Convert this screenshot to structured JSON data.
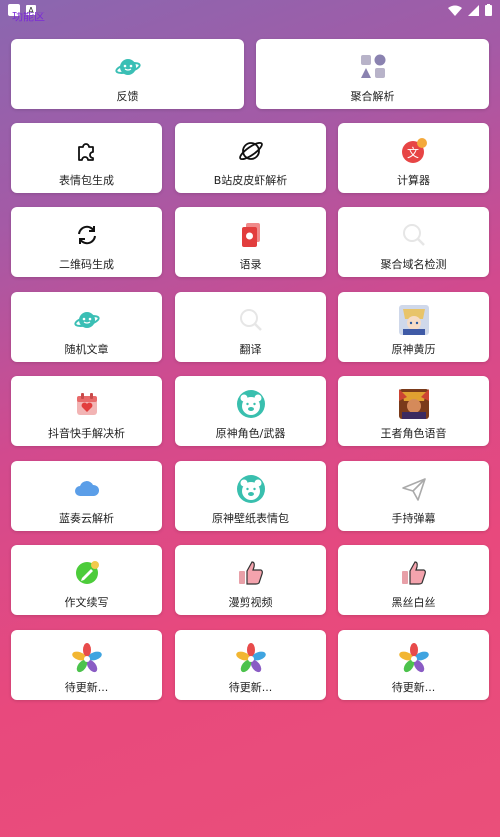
{
  "page_title": "功能区",
  "row0": [
    {
      "label": "反馈",
      "icon": "planet-emoji-icon"
    },
    {
      "label": "聚合解析",
      "icon": "shapes-icon"
    }
  ],
  "grid": [
    {
      "label": "表情包生成",
      "icon": "puzzle-icon"
    },
    {
      "label": "B站皮皮虾解析",
      "icon": "planet-outline-icon"
    },
    {
      "label": "计算器",
      "icon": "translate-badge-icon"
    },
    {
      "label": "二维码生成",
      "icon": "refresh-icon"
    },
    {
      "label": "语录",
      "icon": "red-book-icon"
    },
    {
      "label": "聚合域名检测",
      "icon": "search-icon"
    },
    {
      "label": "随机文章",
      "icon": "planet-emoji-icon"
    },
    {
      "label": "翻译",
      "icon": "search-icon"
    },
    {
      "label": "原神黄历",
      "icon": "anime-avatar-icon"
    },
    {
      "label": "抖音快手解决析",
      "icon": "calendar-heart-icon"
    },
    {
      "label": "原神角色/武器",
      "icon": "bear-face-icon"
    },
    {
      "label": "王者角色语音",
      "icon": "game-avatar-icon"
    },
    {
      "label": "蓝奏云解析",
      "icon": "cloud-icon"
    },
    {
      "label": "原神壁纸表情包",
      "icon": "bear-face-icon"
    },
    {
      "label": "手持弹幕",
      "icon": "paper-plane-icon"
    },
    {
      "label": "作文续写",
      "icon": "pencil-badge-icon"
    },
    {
      "label": "漫剪视频",
      "icon": "thumbs-up-icon"
    },
    {
      "label": "黑丝白丝",
      "icon": "thumbs-up-icon"
    },
    {
      "label": "待更新...",
      "icon": "flower-icon"
    },
    {
      "label": "待更新...",
      "icon": "flower-icon"
    },
    {
      "label": "待更新...",
      "icon": "flower-icon"
    }
  ]
}
